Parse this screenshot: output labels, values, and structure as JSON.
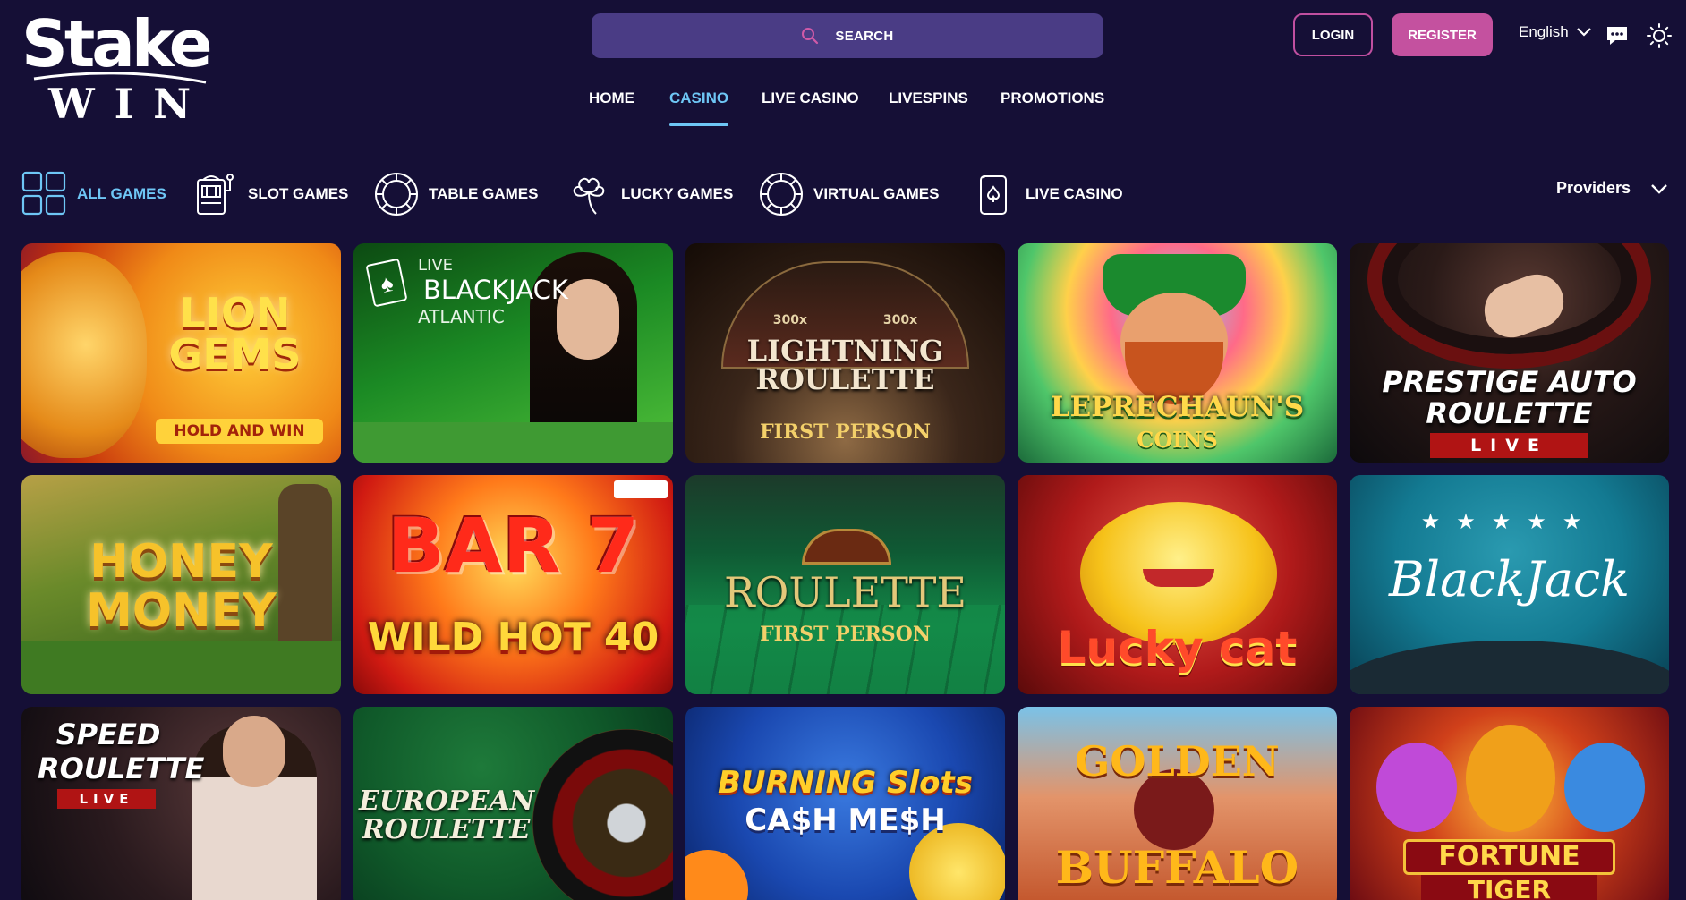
{
  "logo": {
    "line1": "Stake",
    "line2": "WIN"
  },
  "search": {
    "label": "SEARCH"
  },
  "auth": {
    "login": "LOGIN",
    "register": "REGISTER"
  },
  "language": "English",
  "nav": [
    {
      "label": "HOME"
    },
    {
      "label": "CASINO",
      "active": true
    },
    {
      "label": "LIVE CASINO"
    },
    {
      "label": "LIVESPINS"
    },
    {
      "label": "PROMOTIONS"
    }
  ],
  "categories": [
    {
      "label": "ALL GAMES",
      "icon": "grid-icon",
      "active": true
    },
    {
      "label": "SLOT GAMES",
      "icon": "slot-machine-icon"
    },
    {
      "label": "TABLE GAMES",
      "icon": "chip-icon"
    },
    {
      "label": "LUCKY GAMES",
      "icon": "clover-icon"
    },
    {
      "label": "VIRTUAL GAMES",
      "icon": "chip-icon"
    },
    {
      "label": "LIVE CASINO",
      "icon": "card-icon"
    }
  ],
  "providers": "Providers",
  "games": [
    {
      "title": "LION GEMS",
      "subtitle": "HOLD AND WIN"
    },
    {
      "title": "BLACKJACK",
      "top": "LIVE",
      "subtitle": "ATLANTIC"
    },
    {
      "title": "LIGHTNING ROULETTE",
      "subtitle": "FIRST PERSON",
      "top": "300x 300x"
    },
    {
      "title": "LEPRECHAUN'S",
      "subtitle": "COINS"
    },
    {
      "title": "PRESTIGE AUTO ROULETTE",
      "subtitle": "LIVE"
    },
    {
      "title": "HONEY MONEY"
    },
    {
      "title": "WILD HOT 40",
      "top": "BAR 7"
    },
    {
      "title": "ROULETTE",
      "subtitle": "FIRST PERSON"
    },
    {
      "title": "Lucky cat"
    },
    {
      "title": "BlackJack"
    },
    {
      "title": "SPEED ROULETTE",
      "subtitle": "LIVE"
    },
    {
      "title": "EUROPEAN ROULETTE"
    },
    {
      "title": "BURNING Slots",
      "subtitle": "CA$H ME$H"
    },
    {
      "title": "GOLDEN",
      "subtitle": "BUFFALO"
    },
    {
      "title": "FORTUNE",
      "subtitle": "TIGER"
    }
  ],
  "colors": {
    "background": "#150f36",
    "search": "#4a3c85",
    "accent": "#6ec6f5",
    "register": "#c4519f"
  }
}
